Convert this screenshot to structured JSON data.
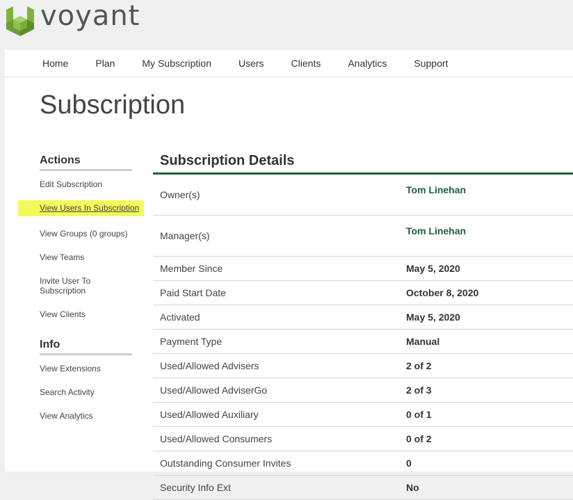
{
  "brand": {
    "name": "voyant",
    "colors": {
      "accent": "#1f5e3b",
      "highlight": "#f3fb5c",
      "logo_green": "#7fb23f"
    }
  },
  "nav": [
    "Home",
    "Plan",
    "My Subscription",
    "Users",
    "Clients",
    "Analytics",
    "Support"
  ],
  "page_title": "Subscription",
  "sidebar": {
    "actions_heading": "Actions",
    "actions": [
      "Edit Subscription",
      "View Users In Subscription",
      "View Groups (0 groups)",
      "View Teams",
      "Invite User To Subscription",
      "View Clients"
    ],
    "info_heading": "Info",
    "info": [
      "View Extensions",
      "Search Activity",
      "View Analytics"
    ]
  },
  "details": {
    "heading": "Subscription Details",
    "rows": [
      {
        "label": "Owner(s)",
        "value": "Tom Linehan"
      },
      {
        "label": "Manager(s)",
        "value": "Tom Linehan"
      },
      {
        "label": "Member Since",
        "value": "May 5, 2020"
      },
      {
        "label": "Paid Start Date",
        "value": "October 8, 2020"
      },
      {
        "label": "Activated",
        "value": "May 5, 2020"
      },
      {
        "label": "Payment Type",
        "value": "Manual"
      },
      {
        "label": "Used/Allowed Advisers",
        "value": "2 of 2"
      },
      {
        "label": "Used/Allowed AdviserGo",
        "value": "2 of 3"
      },
      {
        "label": "Used/Allowed Auxiliary",
        "value": "0 of 1"
      },
      {
        "label": "Used/Allowed Consumers",
        "value": "0 of 2"
      },
      {
        "label": "Outstanding Consumer Invites",
        "value": "0"
      },
      {
        "label": "Security Info Ext",
        "value": "No"
      }
    ]
  }
}
